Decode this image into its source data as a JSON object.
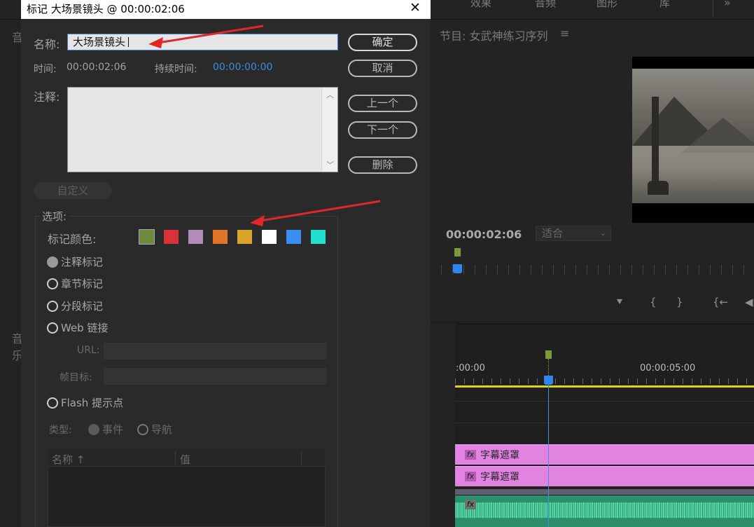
{
  "top_nav": {
    "effects": "效果",
    "audio": "音频",
    "graphics": "图形",
    "library": "库",
    "more": "»"
  },
  "left_strip": {
    "tab1": "音",
    "tab2": "音乐"
  },
  "program": {
    "title": "节目: 女武神练习序列",
    "menu_icon": "≡",
    "timecode": "00:00:02:06",
    "fit_label": "适合",
    "controls": [
      "⯆",
      "{",
      "}",
      "{←",
      "◀"
    ]
  },
  "timeline": {
    "tc_start": ":00:00",
    "tc_5s": "00:00:05:00",
    "clips": [
      {
        "fx": "fx",
        "name": "字幕遮罩"
      },
      {
        "fx": "fx",
        "name": "字幕遮罩"
      }
    ],
    "audio_fx": "fx"
  },
  "dialog": {
    "title": "标记 大场景镜头 @ 00:00:02:06",
    "close_icon": "✕",
    "name_label": "名称:",
    "name_value": "大场景镜头",
    "time_label": "时间:",
    "time_value": "00:00:02:06",
    "duration_label": "持续时间:",
    "duration_value": "00:00:00:00",
    "comment_label": "注释:",
    "comment_value": "",
    "buttons": {
      "ok": "确定",
      "cancel": "取消",
      "prev": "上一个",
      "next": "下一个",
      "delete": "删除",
      "custom": "自定义"
    },
    "options_legend": "选项:",
    "marker_color_label": "标记颜色:",
    "colors": [
      "#6f8a3a",
      "#d9323a",
      "#b28cb8",
      "#e27428",
      "#d7a52a",
      "#ffffff",
      "#3a8ef0",
      "#22ded0"
    ],
    "marker_types": {
      "comment": "注释标记",
      "chapter": "章节标记",
      "segment": "分段标记",
      "web": "Web 链接",
      "flash": "Flash 提示点"
    },
    "url_label": "URL:",
    "frame_target_label": "帧目标:",
    "type_label": "类型:",
    "type_event": "事件",
    "type_nav": "导航",
    "table_col_name": "名称",
    "table_col_sort": "↑",
    "table_col_value": "值"
  },
  "accents": {
    "annotation_arrow": "#e0282a",
    "playhead": "#2f86ec",
    "work_area": "#e2d312",
    "clip_pink": "#e183e1",
    "clip_audio": "#2c8f6c"
  }
}
